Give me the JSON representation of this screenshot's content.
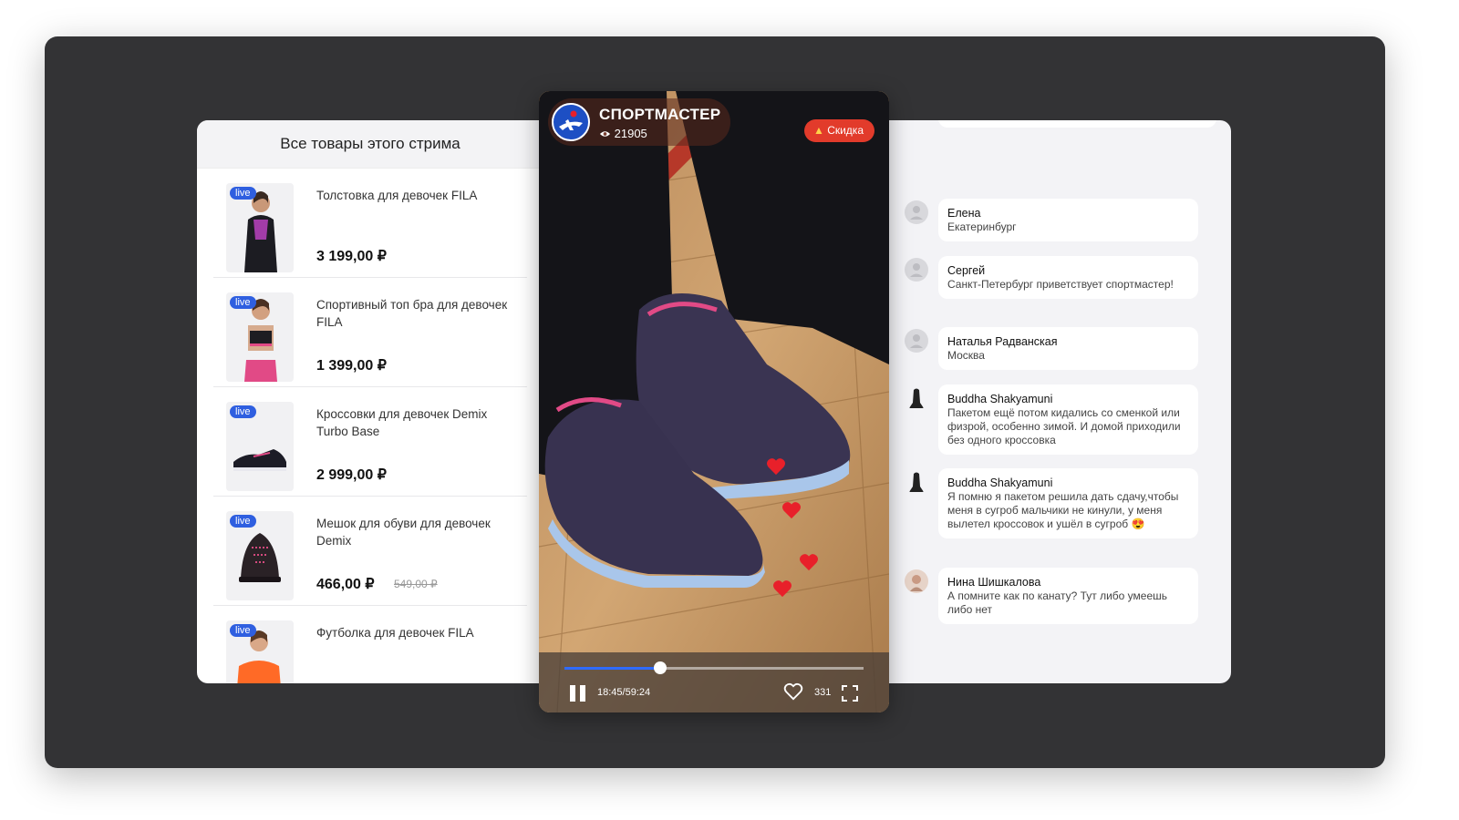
{
  "products": {
    "header": "Все товары этого стрима",
    "items": [
      {
        "badge": "live",
        "name": "Толстовка для девочек FILA",
        "price": "3 199,00 ₽",
        "old_price": ""
      },
      {
        "badge": "live",
        "name": "Спортивный топ бра для девочек FILA",
        "price": "1 399,00 ₽",
        "old_price": ""
      },
      {
        "badge": "live",
        "name": "Кроссовки для девочек Demix Turbo Base",
        "price": "2 999,00 ₽",
        "old_price": ""
      },
      {
        "badge": "live",
        "name": "Мешок для обуви для девочек Demix",
        "price": "466,00 ₽",
        "old_price": "549,00 ₽"
      },
      {
        "badge": "live",
        "name": "Футболка для девочек FILA",
        "price": "",
        "old_price": ""
      }
    ]
  },
  "player": {
    "brand": "СПОРТМАСТЕР",
    "viewers": "21905",
    "sale_label": "Скидка",
    "time": "18:45/59:24",
    "likes": "331",
    "progress_fraction": 0.32
  },
  "chat": {
    "messages": [
      {
        "author": "Елена",
        "text": "Екатеринбург",
        "avatar": "placeholder-avatar"
      },
      {
        "author": "Сергей",
        "text": "Санкт-Петербург приветствует спортмастер!",
        "avatar": "placeholder-avatar"
      },
      {
        "author": "Наталья Радванская",
        "text": "Москва",
        "avatar": "placeholder-avatar"
      },
      {
        "author": "Buddha Shakyamuni",
        "text": "Пакетом ещё потом кидались со сменкой или физрой, особенно зимой. И домой приходили без одного кроссовка",
        "avatar": "statue-avatar"
      },
      {
        "author": "Buddha Shakyamuni",
        "text": "Я помню я пакетом решила дать сдачу,чтобы меня в сугроб мальчики не кинули, у меня вылетел кроссовок и ушёл в сугроб 😍",
        "avatar": "statue-avatar"
      },
      {
        "author": "Нина Шишкалова",
        "text": "А помните как по канату? Тут либо умеешь либо нет",
        "avatar": "photo-avatar"
      }
    ]
  },
  "colors": {
    "frame": "#333335",
    "accent_blue": "#2f5fe0",
    "sale_red": "#e23b2b",
    "heart_red": "#e8202a"
  }
}
